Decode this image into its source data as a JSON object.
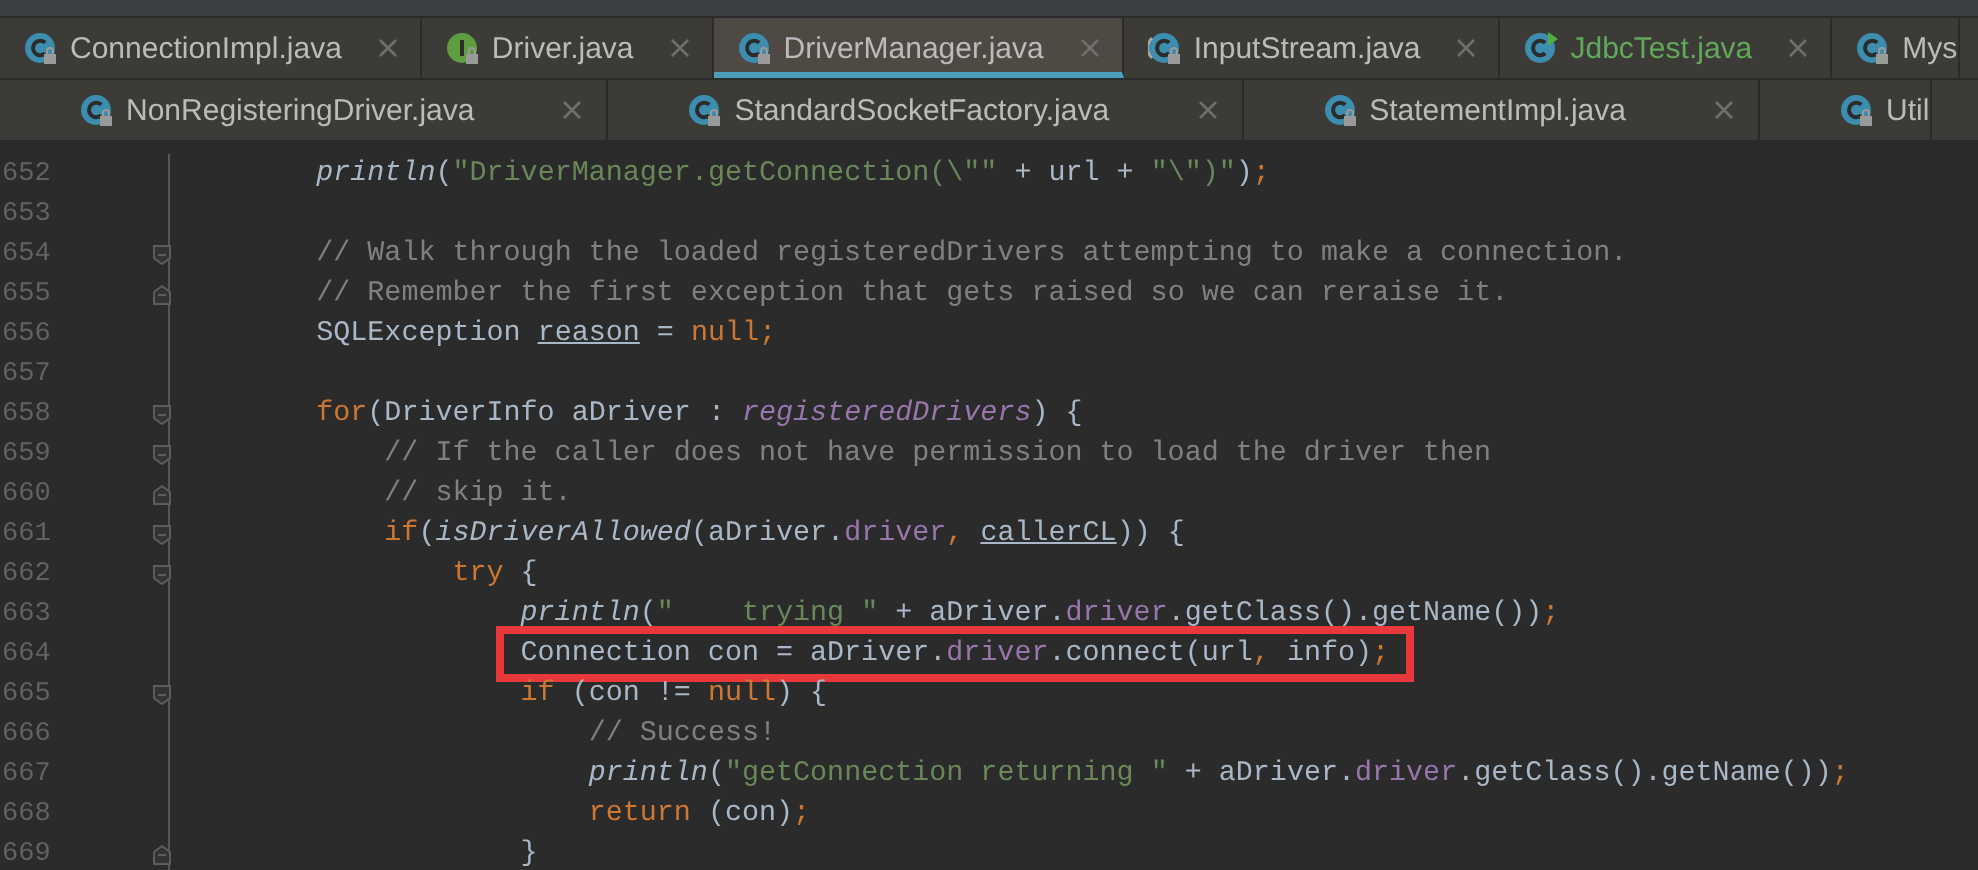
{
  "editor_tabs": [
    [
      {
        "label": "ConnectionImpl.java",
        "kind": "class",
        "locked": true,
        "selected": false,
        "closable": true,
        "added": false
      },
      {
        "label": "Driver.java",
        "kind": "interface",
        "locked": true,
        "selected": false,
        "closable": true,
        "added": false
      },
      {
        "label": "DriverManager.java",
        "kind": "class",
        "locked": true,
        "selected": true,
        "closable": true,
        "added": false
      },
      {
        "label": "InputStream.java",
        "kind": "abstract",
        "locked": true,
        "selected": false,
        "closable": true,
        "added": false
      },
      {
        "label": "JdbcTest.java",
        "kind": "runnable",
        "locked": false,
        "selected": false,
        "closable": true,
        "added": true
      },
      {
        "label": "Mys",
        "kind": "class",
        "locked": true,
        "selected": false,
        "closable": false,
        "added": false
      }
    ],
    [
      {
        "label": "NonRegisteringDriver.java",
        "kind": "class",
        "locked": true,
        "selected": false,
        "closable": true,
        "added": false
      },
      {
        "label": "StandardSocketFactory.java",
        "kind": "class",
        "locked": true,
        "selected": false,
        "closable": true,
        "added": false
      },
      {
        "label": "StatementImpl.java",
        "kind": "class",
        "locked": true,
        "selected": false,
        "closable": true,
        "added": false
      },
      {
        "label": "Util",
        "kind": "class",
        "locked": true,
        "selected": false,
        "closable": false,
        "added": false
      }
    ]
  ],
  "code_lines": [
    {
      "number": "652",
      "boxed": false,
      "tokens": [
        {
          "kind": "method",
          "text": "        println"
        },
        {
          "kind": "plain",
          "text": "("
        },
        {
          "kind": "string",
          "text": "\"DriverManager.getConnection(\\\"\""
        },
        {
          "kind": "plain",
          "text": " + url + "
        },
        {
          "kind": "string",
          "text": "\"\\\")\""
        },
        {
          "kind": "plain",
          "text": ")"
        },
        {
          "kind": "punct",
          "text": ";"
        }
      ]
    },
    {
      "number": "653"
    },
    {
      "number": "654",
      "block_start": true,
      "boxed": false,
      "tokens": [
        {
          "kind": "comment",
          "text": "        // Walk through the loaded registeredDrivers attempting to make a connection."
        }
      ]
    },
    {
      "number": "655",
      "block_end": true,
      "boxed": false,
      "tokens": [
        {
          "kind": "comment",
          "text": "        // Remember the first exception that gets raised so we can reraise it."
        }
      ]
    },
    {
      "number": "656",
      "boxed": false,
      "tokens": [
        {
          "kind": "plain",
          "text": "        SQLException "
        },
        {
          "kind": "reassigned",
          "text": "reason"
        },
        {
          "kind": "plain",
          "text": " = "
        },
        {
          "kind": "keyword",
          "text": "null"
        },
        {
          "kind": "punct",
          "text": ";"
        }
      ]
    },
    {
      "number": "657"
    },
    {
      "number": "658",
      "block_start": true,
      "boxed": false,
      "tokens": [
        {
          "kind": "keyword",
          "text": "        for"
        },
        {
          "kind": "plain",
          "text": "(DriverInfo aDriver : "
        },
        {
          "kind": "static_field",
          "text": "registeredDrivers"
        },
        {
          "kind": "plain",
          "text": ") {"
        }
      ]
    },
    {
      "number": "659",
      "block_start": true,
      "boxed": false,
      "tokens": [
        {
          "kind": "comment",
          "text": "            // If the caller does not have permission to load the driver then"
        }
      ]
    },
    {
      "number": "660",
      "block_end": true,
      "boxed": false,
      "tokens": [
        {
          "kind": "comment",
          "text": "            // skip it."
        }
      ]
    },
    {
      "number": "661",
      "block_start": true,
      "boxed": false,
      "tokens": [
        {
          "kind": "keyword",
          "text": "            if"
        },
        {
          "kind": "plain",
          "text": "("
        },
        {
          "kind": "method",
          "text": "isDriverAllowed"
        },
        {
          "kind": "plain",
          "text": "(aDriver."
        },
        {
          "kind": "field",
          "text": "driver"
        },
        {
          "kind": "punct",
          "text": ", "
        },
        {
          "kind": "reassigned",
          "text": "callerCL"
        },
        {
          "kind": "plain",
          "text": ")) {"
        }
      ]
    },
    {
      "number": "662",
      "block_start": true,
      "boxed": false,
      "tokens": [
        {
          "kind": "keyword",
          "text": "                try"
        },
        {
          "kind": "plain",
          "text": " {"
        }
      ]
    },
    {
      "number": "663",
      "boxed": false,
      "tokens": [
        {
          "kind": "method",
          "text": "                    println"
        },
        {
          "kind": "plain",
          "text": "("
        },
        {
          "kind": "string",
          "text": "\"    trying \""
        },
        {
          "kind": "plain",
          "text": " + aDriver."
        },
        {
          "kind": "field",
          "text": "driver"
        },
        {
          "kind": "plain",
          "text": ".getClass().getName())"
        },
        {
          "kind": "punct",
          "text": ";"
        }
      ]
    },
    {
      "number": "664",
      "boxed": true,
      "tokens": [
        {
          "kind": "plain",
          "text": "                    Connection con = aDriver."
        },
        {
          "kind": "field",
          "text": "driver"
        },
        {
          "kind": "plain",
          "text": ".connect(url"
        },
        {
          "kind": "punct",
          "text": ", "
        },
        {
          "kind": "plain",
          "text": "info)"
        },
        {
          "kind": "punct",
          "text": ";"
        }
      ]
    },
    {
      "number": "665",
      "block_start": true,
      "boxed": false,
      "tokens": [
        {
          "kind": "keyword",
          "text": "                    if"
        },
        {
          "kind": "plain",
          "text": " (con != "
        },
        {
          "kind": "keyword",
          "text": "null"
        },
        {
          "kind": "plain",
          "text": ") {"
        }
      ]
    },
    {
      "number": "666",
      "boxed": false,
      "tokens": [
        {
          "kind": "comment",
          "text": "                        // Success!"
        }
      ]
    },
    {
      "number": "667",
      "boxed": false,
      "tokens": [
        {
          "kind": "method",
          "text": "                        println"
        },
        {
          "kind": "plain",
          "text": "("
        },
        {
          "kind": "string",
          "text": "\"getConnection returning \""
        },
        {
          "kind": "plain",
          "text": " + aDriver."
        },
        {
          "kind": "field",
          "text": "driver"
        },
        {
          "kind": "plain",
          "text": ".getClass().getName())"
        },
        {
          "kind": "punct",
          "text": ";"
        }
      ]
    },
    {
      "number": "668",
      "boxed": false,
      "tokens": [
        {
          "kind": "keyword",
          "text": "                        return"
        },
        {
          "kind": "plain",
          "text": " (con)"
        },
        {
          "kind": "punct",
          "text": ";"
        }
      ]
    },
    {
      "number": "669",
      "block_end": true,
      "boxed": false,
      "tokens": [
        {
          "kind": "plain",
          "text": "                    }"
        }
      ]
    }
  ]
}
